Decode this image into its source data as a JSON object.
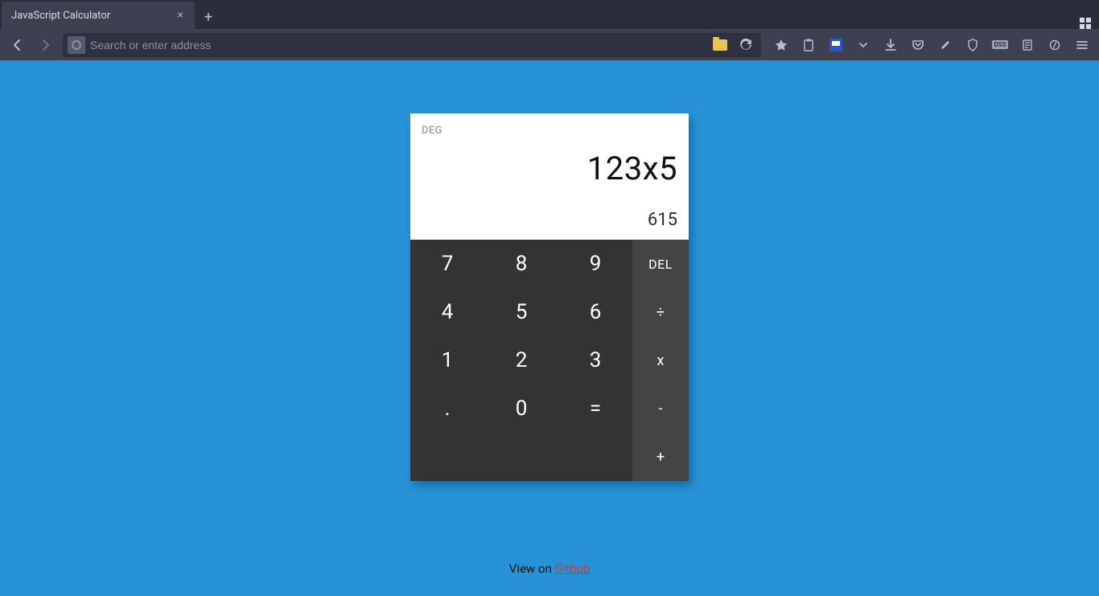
{
  "browser": {
    "tab_title": "JavaScript Calculator",
    "url_placeholder": "Search or enter address"
  },
  "calc": {
    "mode": "DEG",
    "expression": "123x5",
    "result": "615",
    "keys": {
      "n7": "7",
      "n8": "8",
      "n9": "9",
      "del": "DEL",
      "n4": "4",
      "n5": "5",
      "n6": "6",
      "div": "÷",
      "n1": "1",
      "n2": "2",
      "n3": "3",
      "mul": "x",
      "dot": ".",
      "n0": "0",
      "eq": "=",
      "sub": "-",
      "add": "+"
    }
  },
  "footer": {
    "prefix": "View on ",
    "link": "Github"
  }
}
